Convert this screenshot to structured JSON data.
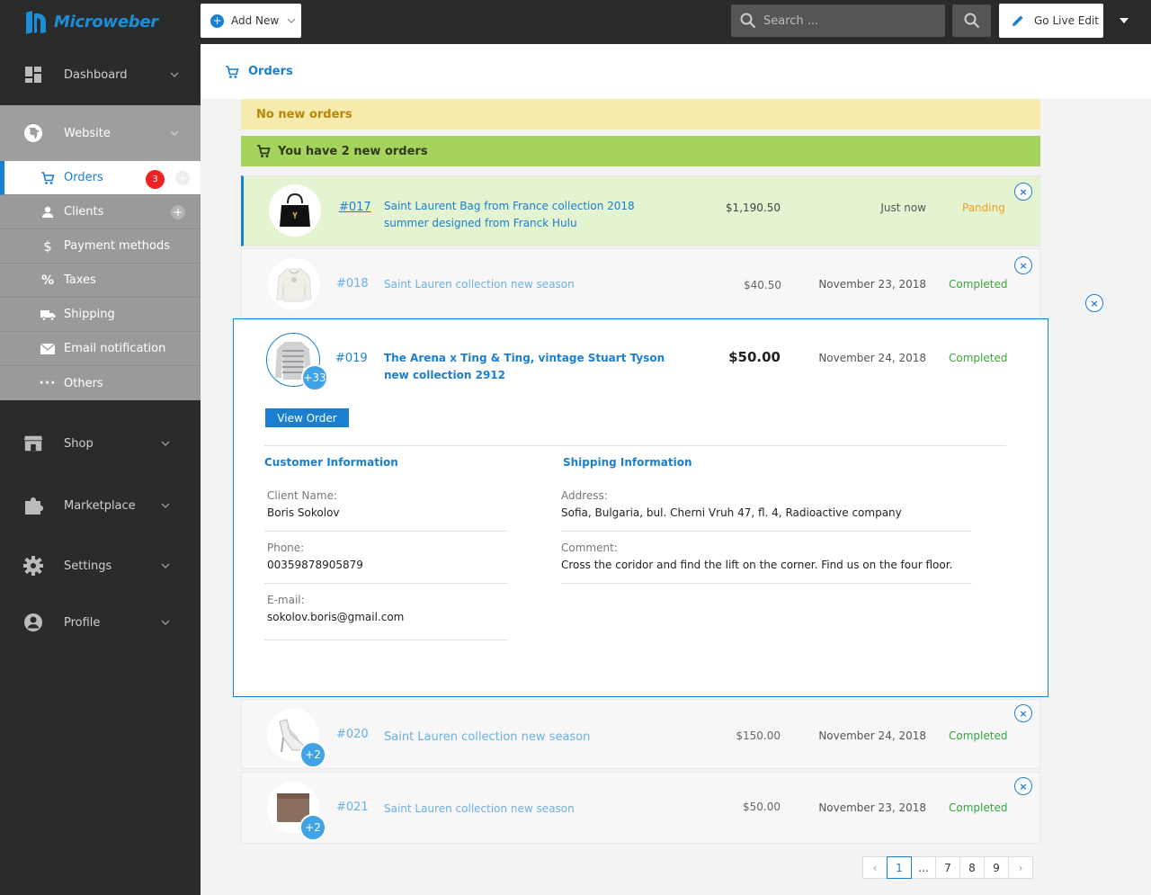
{
  "app": {
    "logo_text": "Microweber"
  },
  "sidebar": {
    "dashboard": "Dashboard",
    "website": "Website",
    "submenu": [
      {
        "label": "Orders",
        "icon": "cart-icon",
        "badge": "3",
        "active": true
      },
      {
        "label": "Clients",
        "icon": "user-icon"
      },
      {
        "label": "Payment methods",
        "icon": "dollar-icon"
      },
      {
        "label": "Taxes",
        "icon": "percent-icon"
      },
      {
        "label": "Shipping",
        "icon": "truck-icon"
      },
      {
        "label": "Email notification",
        "icon": "envelope-icon"
      },
      {
        "label": "Others",
        "icon": "dots-icon"
      }
    ],
    "shop": "Shop",
    "marketplace": "Marketplace",
    "settings": "Settings",
    "profile": "Profile"
  },
  "topbar": {
    "add_new": "Add New",
    "search_placeholder": "Search ...",
    "go_live": "Go Live Edit"
  },
  "page": {
    "title": "Orders"
  },
  "alerts": {
    "no_new": "No new orders",
    "new_orders": "You have 2 new orders"
  },
  "orders": [
    {
      "id": "#017",
      "title": "Saint Laurent Bag from France collection 2018 summer designed from Franck Hulu",
      "title_line1": "Saint Laurent Bag from France collection 2018",
      "title_line2": "summer designed from Franck Hulu",
      "price": "$1,190.50",
      "date": "Just now",
      "status": "Panding"
    },
    {
      "id": "#018",
      "title": "Saint Lauren collection new season",
      "price": "$40.50",
      "date": "November 23, 2018",
      "status": "Completed"
    },
    {
      "id": "#019",
      "title_line1": "The Arena x Ting & Ting, vintage Stuart Tyson",
      "title_line2": "new collection 2912",
      "price": "$50.00",
      "date": "November 24, 2018",
      "status": "Completed",
      "more": "+33"
    },
    {
      "id": "#020",
      "title": "Saint Lauren collection new season",
      "price": "$150.00",
      "date": "November 24, 2018",
      "status": "Completed",
      "more": "+2"
    },
    {
      "id": "#021",
      "title": "Saint Lauren collection new season",
      "price": "$50.00",
      "date": "November 23, 2018",
      "status": "Completed",
      "more": "+2"
    }
  ],
  "order_detail": {
    "view_button": "View Order",
    "customer_heading": "Customer Information",
    "shipping_heading": "Shipping Information",
    "client_name_label": "Client Name:",
    "client_name": "Boris Sokolov",
    "phone_label": "Phone:",
    "phone": "00359878905879",
    "email_label": "E-mail:",
    "email": "sokolov.boris@gmail.com",
    "address_label": "Address:",
    "address": "Sofia, Bulgaria, bul. Cherni Vruh 47, fl. 4, Radioactive company",
    "comment_label": "Comment:",
    "comment": "Cross the coridor and find the lift on the corner. Find us on the four floor."
  },
  "pagination": {
    "prev": "‹",
    "pages": [
      "1",
      "...",
      "7",
      "8",
      "9"
    ],
    "next": "›",
    "current": "1"
  },
  "close_glyph": "×",
  "colors": {
    "accent": "#1a7fd0",
    "sidebar": "#2b2b2b",
    "pending": "#f0a020",
    "completed": "#3aa63a",
    "new_order_bg": "#e4f3d0",
    "warning_bg": "#f7eaad",
    "success_bg": "#a5d45c"
  }
}
